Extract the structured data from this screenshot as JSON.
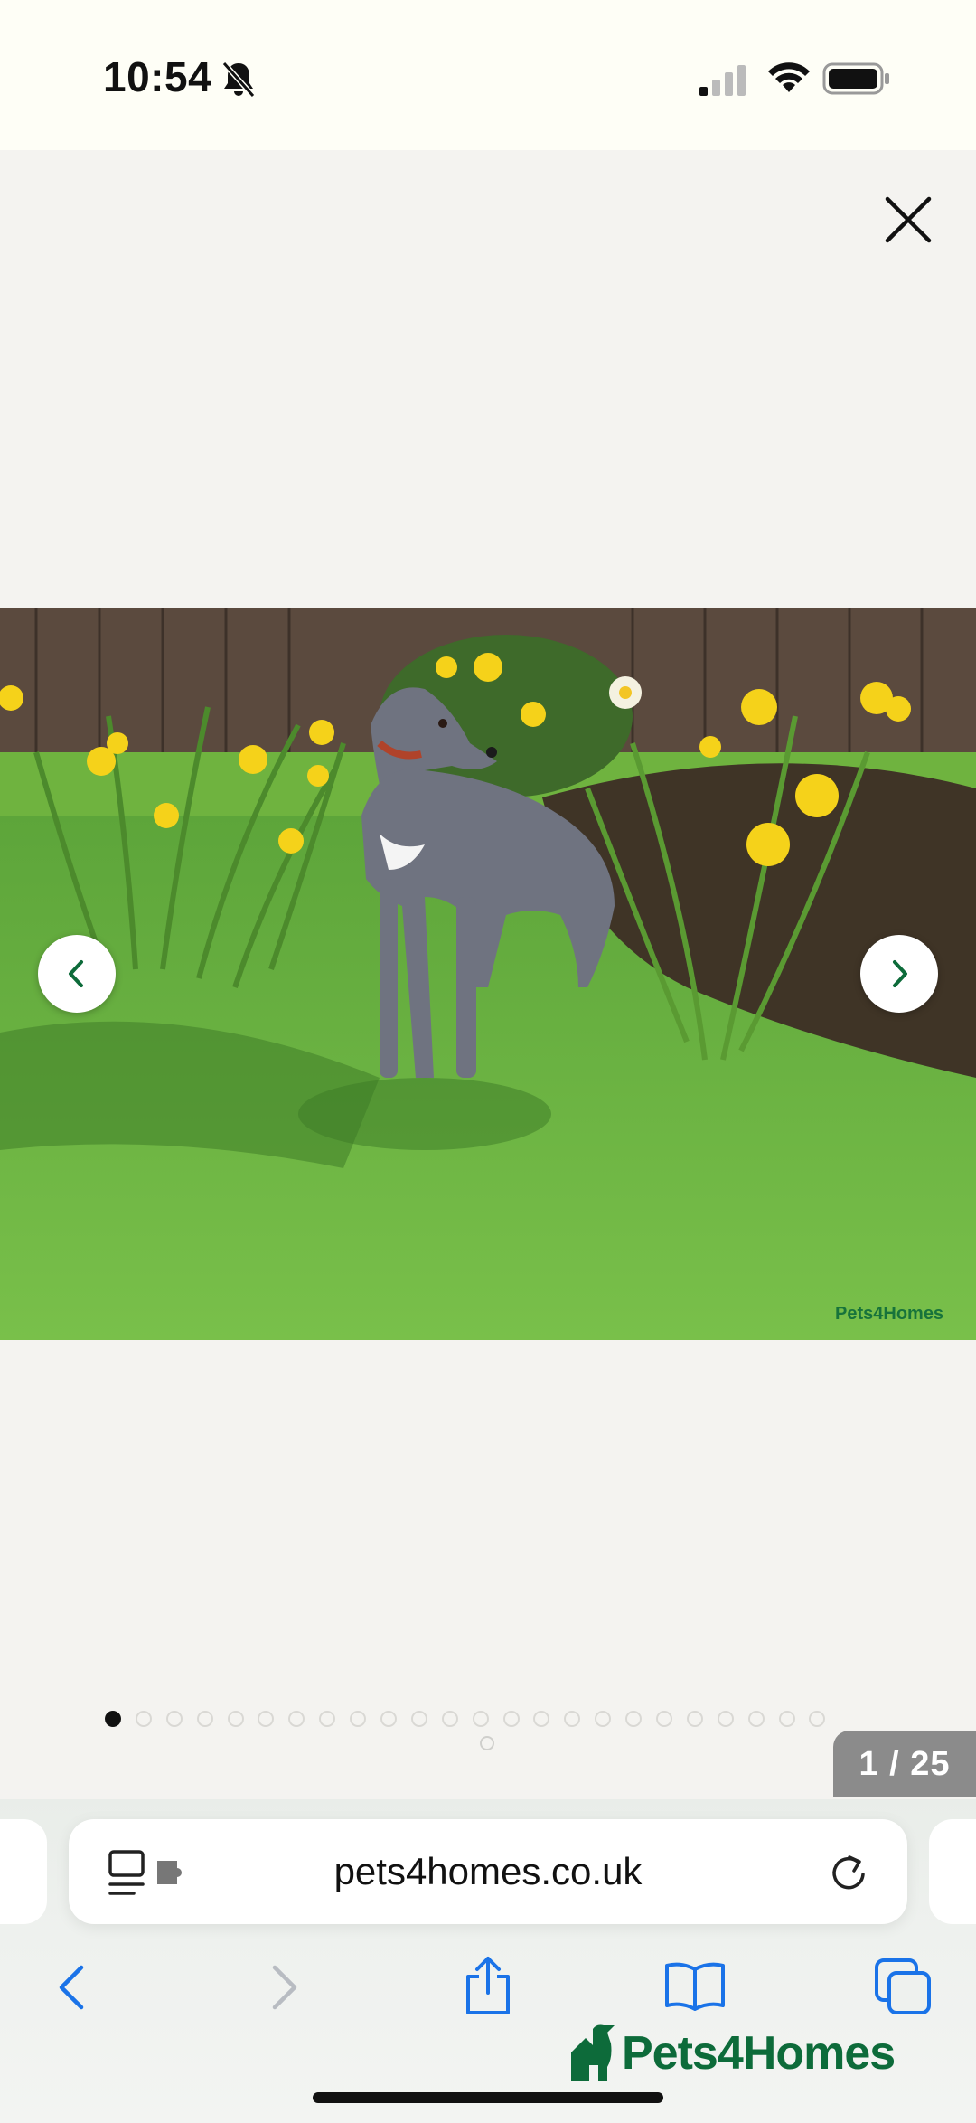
{
  "status_bar": {
    "time": "10:54",
    "icons": [
      "bell-slash-icon",
      "cellular-signal-icon",
      "wifi-icon",
      "battery-icon"
    ]
  },
  "gallery": {
    "close_icon": "close-icon",
    "prev_icon": "chevron-left-icon",
    "next_icon": "chevron-right-icon",
    "photo_subject": "grey whippet dog standing on lawn with daffodils",
    "watermark": "Pets4Homes",
    "counter": "1 / 25",
    "total_images": 25,
    "current_index": 1
  },
  "browser": {
    "url": "pets4homes.co.uk",
    "page_menu_icon": "page-menu-icon",
    "reload_icon": "reload-icon",
    "toolbar": [
      "back-icon",
      "forward-icon",
      "share-icon",
      "bookmarks-icon",
      "tabs-icon"
    ]
  },
  "brand": {
    "name": "Pets4Homes",
    "color": "#0d6b3a"
  },
  "colors": {
    "accent_blue": "#1a73e8",
    "counter_bg": "#8b8b8b"
  }
}
